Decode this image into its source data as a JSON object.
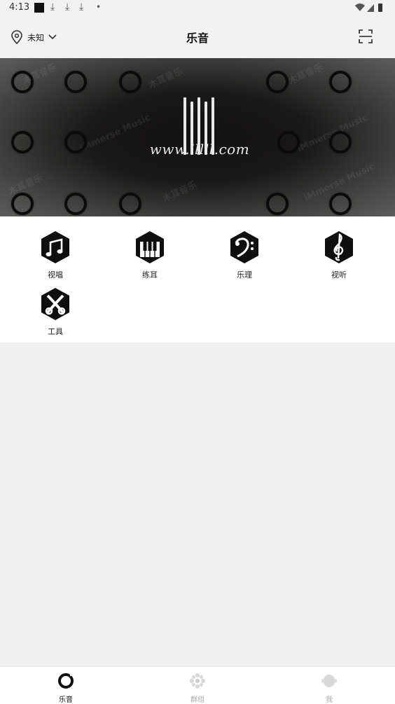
{
  "status_bar": {
    "time": "4:13"
  },
  "header": {
    "location_label": "未知",
    "title": "乐音"
  },
  "banner": {
    "url_text": "www.lllll.com",
    "watermark_cn": "木耳音乐",
    "watermark_en": "iMmerse Music"
  },
  "grid": {
    "items": [
      {
        "label": "视唱",
        "icon": "music-note-icon"
      },
      {
        "label": "练耳",
        "icon": "piano-keys-icon"
      },
      {
        "label": "乐理",
        "icon": "bass-clef-icon"
      },
      {
        "label": "视听",
        "icon": "treble-clef-icon"
      },
      {
        "label": "工具",
        "icon": "tools-icon"
      }
    ]
  },
  "bottom_nav": {
    "items": [
      {
        "label": "乐音",
        "active": true
      },
      {
        "label": "群组",
        "active": false
      },
      {
        "label": "我",
        "active": false
      }
    ]
  },
  "colors": {
    "active": "#111111",
    "inactive": "#bbbbbb",
    "page_bg": "#f0f0f0"
  }
}
